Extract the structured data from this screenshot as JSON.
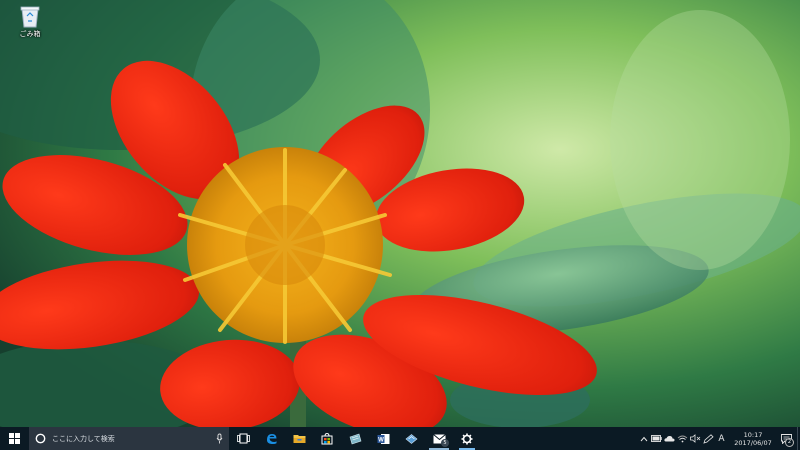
{
  "desktop": {
    "icons": [
      {
        "label": "ごみ箱",
        "icon": "recycle-bin-icon"
      }
    ],
    "wallpaper": "red-flower-wallpaper"
  },
  "taskbar": {
    "start": {
      "icon": "windows-logo-icon"
    },
    "search": {
      "placeholder": "ここに入力して検索",
      "icon": "cortana-circle-icon",
      "mic_icon": "microphone-icon"
    },
    "apps": [
      {
        "icon": "task-view-icon"
      },
      {
        "icon": "edge-icon"
      },
      {
        "icon": "file-explorer-icon"
      },
      {
        "icon": "store-icon"
      },
      {
        "icon": "app-icon-teal"
      },
      {
        "icon": "word-icon"
      },
      {
        "icon": "app-icon-blue"
      },
      {
        "icon": "mail-icon",
        "badge": "5"
      },
      {
        "icon": "settings-gear-icon",
        "active": true
      }
    ],
    "tray": {
      "icons": [
        "chevron-up-icon",
        "battery-icon",
        "onedrive-cloud-icon",
        "wifi-icon",
        "volume-muted-icon",
        "pen-icon"
      ],
      "ime": "A",
      "time": "10:17",
      "date": "2017/06/07",
      "notifications_badge": "2"
    }
  },
  "colors": {
    "taskbar_bg": "#0b1a24",
    "search_bg": "#2b3540",
    "accent": "#76b9ed"
  }
}
